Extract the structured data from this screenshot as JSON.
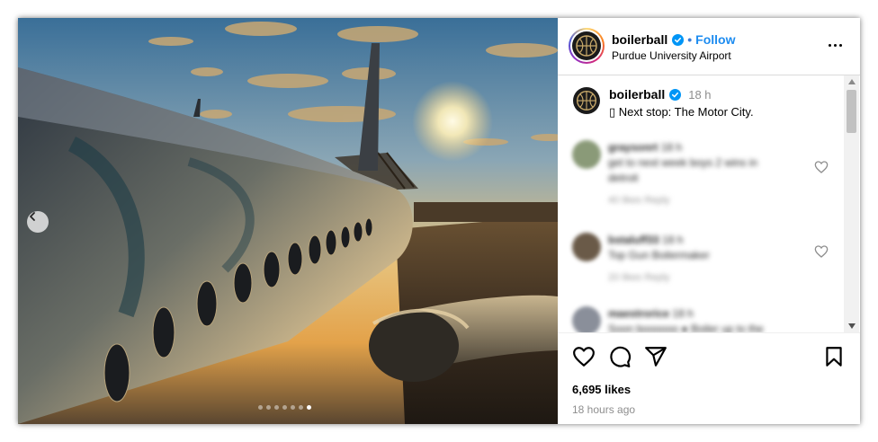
{
  "post": {
    "username": "boilerball",
    "follow_label": "Follow",
    "separator": "•",
    "location": "Purdue University Airport",
    "caption_time": "18 h",
    "caption_text": "▯ Next stop: The Motor City.",
    "likes": "6,695 likes",
    "time_ago": "18 hours ago"
  },
  "carousel": {
    "slide_count": 7,
    "active_index": 6
  },
  "comments": [
    {
      "user": "graysonrt",
      "time": "18 h",
      "text": "get to next week boys 2 wins in",
      "text2": "detroit",
      "meta": "40 likes   Reply"
    },
    {
      "user": "bstaluff33",
      "time": "18 h",
      "text": "Top Gun Boilermaker",
      "text2": "",
      "meta": "20 likes   Reply"
    },
    {
      "user": "maestrorice",
      "time": "18 h",
      "text": "Soon boooooo ● Boiler up to the",
      "text2": "",
      "meta": ""
    }
  ],
  "icons": {
    "more": "more-options-icon",
    "prev": "chevron-left-icon",
    "like": "heart-icon",
    "comment": "comment-icon",
    "share": "share-icon",
    "save": "bookmark-icon",
    "verified": "verified-badge-icon"
  },
  "colors": {
    "verified": "#0095f6",
    "follow": "#0095f6",
    "muted": "#8e8e8e"
  }
}
